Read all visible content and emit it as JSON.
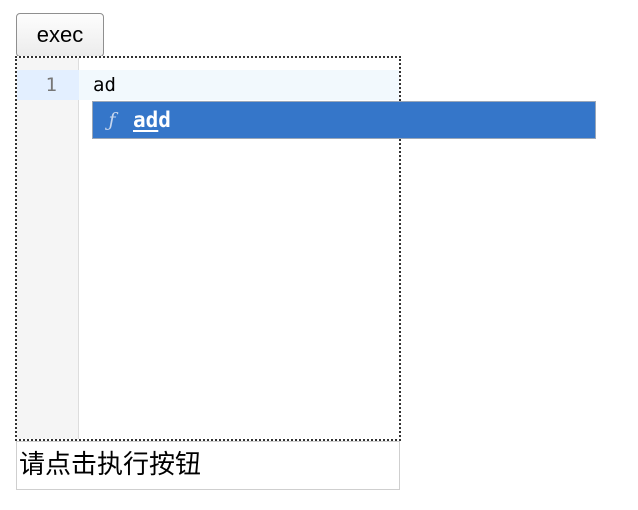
{
  "toolbar": {
    "exec_label": "exec"
  },
  "editor": {
    "line_numbers": [
      "1"
    ],
    "lines": [
      "ad"
    ],
    "autocomplete": {
      "items": [
        {
          "icon": "function-icon",
          "icon_glyph": "ƒ",
          "matched": "ad",
          "rest": "d",
          "selected": true
        }
      ]
    }
  },
  "output": {
    "text": "请点击执行按钮"
  },
  "colors": {
    "selection": "#3576c9",
    "active_line": "#f2f9fd",
    "gutter": "#f5f5f5",
    "gutter_active": "#e3efff"
  }
}
